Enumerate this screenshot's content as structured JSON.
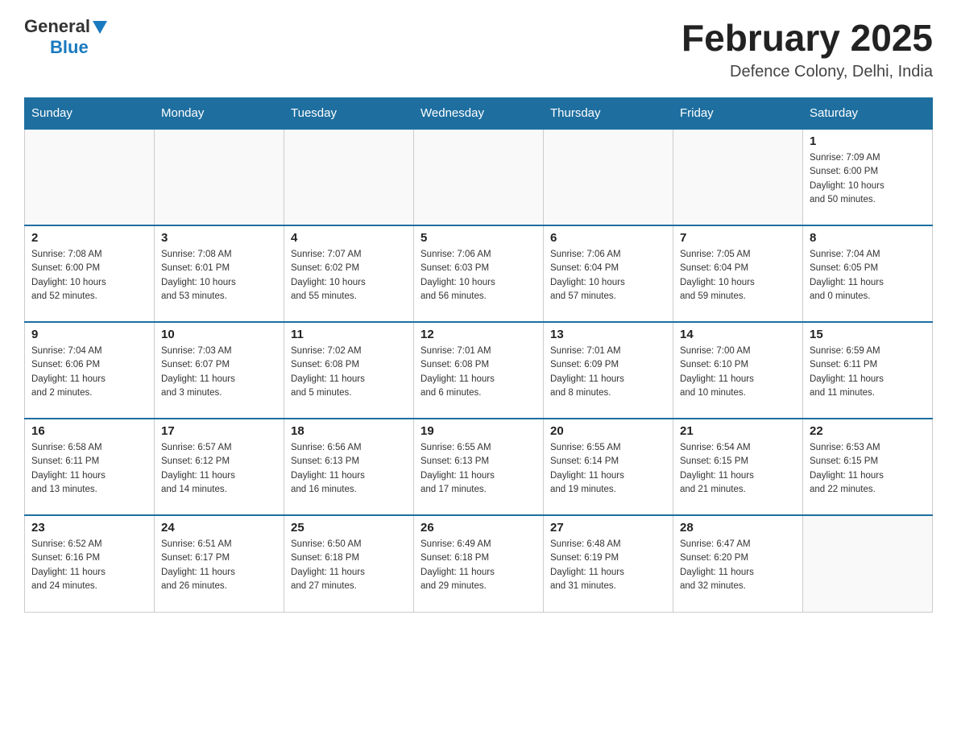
{
  "header": {
    "logo_general": "General",
    "logo_blue": "Blue",
    "month_title": "February 2025",
    "location": "Defence Colony, Delhi, India"
  },
  "weekdays": [
    "Sunday",
    "Monday",
    "Tuesday",
    "Wednesday",
    "Thursday",
    "Friday",
    "Saturday"
  ],
  "weeks": [
    [
      {
        "day": "",
        "info": ""
      },
      {
        "day": "",
        "info": ""
      },
      {
        "day": "",
        "info": ""
      },
      {
        "day": "",
        "info": ""
      },
      {
        "day": "",
        "info": ""
      },
      {
        "day": "",
        "info": ""
      },
      {
        "day": "1",
        "info": "Sunrise: 7:09 AM\nSunset: 6:00 PM\nDaylight: 10 hours\nand 50 minutes."
      }
    ],
    [
      {
        "day": "2",
        "info": "Sunrise: 7:08 AM\nSunset: 6:00 PM\nDaylight: 10 hours\nand 52 minutes."
      },
      {
        "day": "3",
        "info": "Sunrise: 7:08 AM\nSunset: 6:01 PM\nDaylight: 10 hours\nand 53 minutes."
      },
      {
        "day": "4",
        "info": "Sunrise: 7:07 AM\nSunset: 6:02 PM\nDaylight: 10 hours\nand 55 minutes."
      },
      {
        "day": "5",
        "info": "Sunrise: 7:06 AM\nSunset: 6:03 PM\nDaylight: 10 hours\nand 56 minutes."
      },
      {
        "day": "6",
        "info": "Sunrise: 7:06 AM\nSunset: 6:04 PM\nDaylight: 10 hours\nand 57 minutes."
      },
      {
        "day": "7",
        "info": "Sunrise: 7:05 AM\nSunset: 6:04 PM\nDaylight: 10 hours\nand 59 minutes."
      },
      {
        "day": "8",
        "info": "Sunrise: 7:04 AM\nSunset: 6:05 PM\nDaylight: 11 hours\nand 0 minutes."
      }
    ],
    [
      {
        "day": "9",
        "info": "Sunrise: 7:04 AM\nSunset: 6:06 PM\nDaylight: 11 hours\nand 2 minutes."
      },
      {
        "day": "10",
        "info": "Sunrise: 7:03 AM\nSunset: 6:07 PM\nDaylight: 11 hours\nand 3 minutes."
      },
      {
        "day": "11",
        "info": "Sunrise: 7:02 AM\nSunset: 6:08 PM\nDaylight: 11 hours\nand 5 minutes."
      },
      {
        "day": "12",
        "info": "Sunrise: 7:01 AM\nSunset: 6:08 PM\nDaylight: 11 hours\nand 6 minutes."
      },
      {
        "day": "13",
        "info": "Sunrise: 7:01 AM\nSunset: 6:09 PM\nDaylight: 11 hours\nand 8 minutes."
      },
      {
        "day": "14",
        "info": "Sunrise: 7:00 AM\nSunset: 6:10 PM\nDaylight: 11 hours\nand 10 minutes."
      },
      {
        "day": "15",
        "info": "Sunrise: 6:59 AM\nSunset: 6:11 PM\nDaylight: 11 hours\nand 11 minutes."
      }
    ],
    [
      {
        "day": "16",
        "info": "Sunrise: 6:58 AM\nSunset: 6:11 PM\nDaylight: 11 hours\nand 13 minutes."
      },
      {
        "day": "17",
        "info": "Sunrise: 6:57 AM\nSunset: 6:12 PM\nDaylight: 11 hours\nand 14 minutes."
      },
      {
        "day": "18",
        "info": "Sunrise: 6:56 AM\nSunset: 6:13 PM\nDaylight: 11 hours\nand 16 minutes."
      },
      {
        "day": "19",
        "info": "Sunrise: 6:55 AM\nSunset: 6:13 PM\nDaylight: 11 hours\nand 17 minutes."
      },
      {
        "day": "20",
        "info": "Sunrise: 6:55 AM\nSunset: 6:14 PM\nDaylight: 11 hours\nand 19 minutes."
      },
      {
        "day": "21",
        "info": "Sunrise: 6:54 AM\nSunset: 6:15 PM\nDaylight: 11 hours\nand 21 minutes."
      },
      {
        "day": "22",
        "info": "Sunrise: 6:53 AM\nSunset: 6:15 PM\nDaylight: 11 hours\nand 22 minutes."
      }
    ],
    [
      {
        "day": "23",
        "info": "Sunrise: 6:52 AM\nSunset: 6:16 PM\nDaylight: 11 hours\nand 24 minutes."
      },
      {
        "day": "24",
        "info": "Sunrise: 6:51 AM\nSunset: 6:17 PM\nDaylight: 11 hours\nand 26 minutes."
      },
      {
        "day": "25",
        "info": "Sunrise: 6:50 AM\nSunset: 6:18 PM\nDaylight: 11 hours\nand 27 minutes."
      },
      {
        "day": "26",
        "info": "Sunrise: 6:49 AM\nSunset: 6:18 PM\nDaylight: 11 hours\nand 29 minutes."
      },
      {
        "day": "27",
        "info": "Sunrise: 6:48 AM\nSunset: 6:19 PM\nDaylight: 11 hours\nand 31 minutes."
      },
      {
        "day": "28",
        "info": "Sunrise: 6:47 AM\nSunset: 6:20 PM\nDaylight: 11 hours\nand 32 minutes."
      },
      {
        "day": "",
        "info": ""
      }
    ]
  ]
}
